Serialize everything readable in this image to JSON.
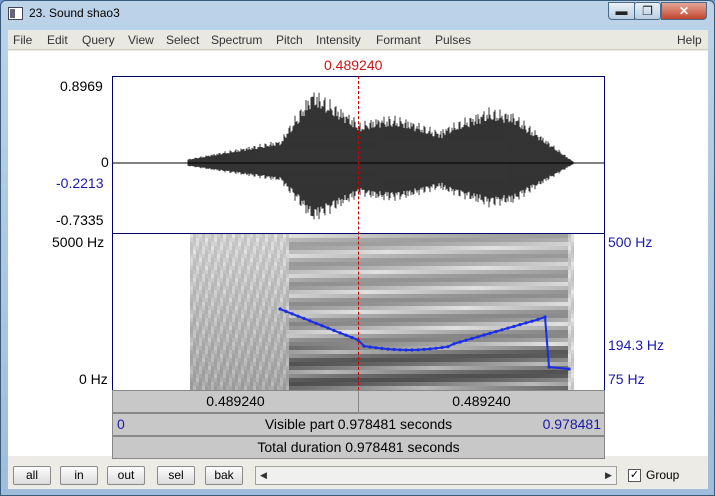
{
  "window": {
    "title": "23. Sound shao3",
    "minimize_symbol": "▬",
    "maximize_symbol": "❐",
    "close_symbol": "✕"
  },
  "menu": [
    "File",
    "Edit",
    "Query",
    "View",
    "Select",
    "Spectrum",
    "Pitch",
    "Intensity",
    "Formant",
    "Pulses",
    "Help"
  ],
  "cursor_time": "0.489240",
  "waveform": {
    "y_max": "0.8969",
    "y_zero": "0",
    "y_value_at_cursor": "-0.2213",
    "y_min": "-0.7335"
  },
  "spectrogram": {
    "freq_max": "5000 Hz",
    "freq_min": "0 Hz"
  },
  "pitch": {
    "ceiling": "500 Hz",
    "value_at_cursor": "194.3 Hz",
    "floor": "75 Hz"
  },
  "time_bar": {
    "left": "0.489240",
    "right": "0.489240"
  },
  "visible": {
    "start": "0",
    "label": "Visible part 0.978481 seconds",
    "end": "0.978481"
  },
  "total": {
    "label": "Total duration 0.978481 seconds"
  },
  "buttons": {
    "all": "all",
    "in": "in",
    "out": "out",
    "sel": "sel",
    "bak": "bak"
  },
  "scroll": {
    "left_arrow": "◀",
    "right_arrow": "▶"
  },
  "group": {
    "label": "Group",
    "checked": true,
    "check_mark": "✓"
  },
  "colors": {
    "cursor": "#cc1414",
    "pitch_track": "#1a2ee6",
    "pitch_labels": "#1a1aaa"
  }
}
